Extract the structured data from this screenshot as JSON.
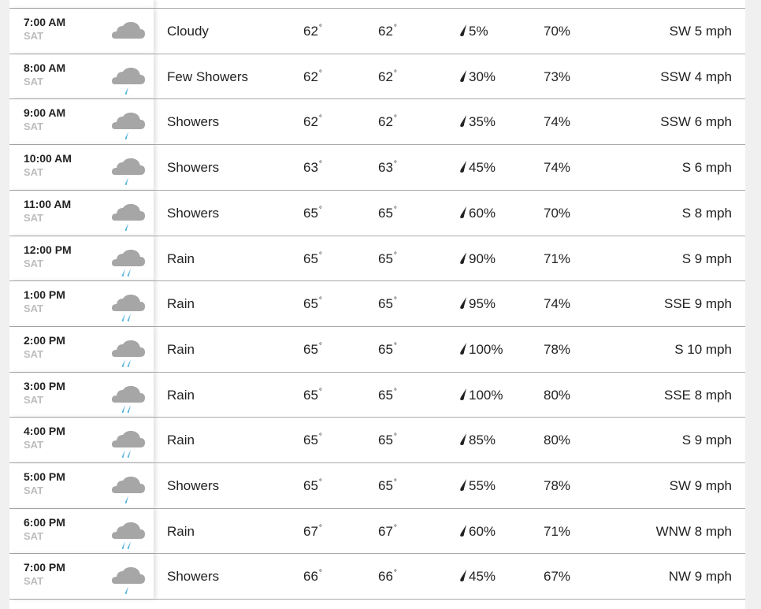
{
  "colors": {
    "cloud": "#a6a6a6",
    "drop": "#5bb6e0",
    "text": "#222222",
    "day": "#bdbdbd"
  },
  "degree_symbol": "°",
  "rows": [
    {
      "time": "7:00 AM",
      "day": "SAT",
      "icon": "cloudy-icon",
      "condition": "Cloudy",
      "temp": "62",
      "feels": "62",
      "precip": "5%",
      "humidity": "70%",
      "wind": "SW 5 mph"
    },
    {
      "time": "8:00 AM",
      "day": "SAT",
      "icon": "showers-icon",
      "condition": "Few Showers",
      "temp": "62",
      "feels": "62",
      "precip": "30%",
      "humidity": "73%",
      "wind": "SSW 4 mph"
    },
    {
      "time": "9:00 AM",
      "day": "SAT",
      "icon": "showers-icon",
      "condition": "Showers",
      "temp": "62",
      "feels": "62",
      "precip": "35%",
      "humidity": "74%",
      "wind": "SSW 6 mph"
    },
    {
      "time": "10:00 AM",
      "day": "SAT",
      "icon": "showers-icon",
      "condition": "Showers",
      "temp": "63",
      "feels": "63",
      "precip": "45%",
      "humidity": "74%",
      "wind": "S 6 mph"
    },
    {
      "time": "11:00 AM",
      "day": "SAT",
      "icon": "showers-icon",
      "condition": "Showers",
      "temp": "65",
      "feels": "65",
      "precip": "60%",
      "humidity": "70%",
      "wind": "S 8 mph"
    },
    {
      "time": "12:00 PM",
      "day": "SAT",
      "icon": "rain-icon",
      "condition": "Rain",
      "temp": "65",
      "feels": "65",
      "precip": "90%",
      "humidity": "71%",
      "wind": "S 9 mph"
    },
    {
      "time": "1:00 PM",
      "day": "SAT",
      "icon": "rain-icon",
      "condition": "Rain",
      "temp": "65",
      "feels": "65",
      "precip": "95%",
      "humidity": "74%",
      "wind": "SSE 9 mph"
    },
    {
      "time": "2:00 PM",
      "day": "SAT",
      "icon": "rain-icon",
      "condition": "Rain",
      "temp": "65",
      "feels": "65",
      "precip": "100%",
      "humidity": "78%",
      "wind": "S 10 mph"
    },
    {
      "time": "3:00 PM",
      "day": "SAT",
      "icon": "rain-icon",
      "condition": "Rain",
      "temp": "65",
      "feels": "65",
      "precip": "100%",
      "humidity": "80%",
      "wind": "SSE 8 mph"
    },
    {
      "time": "4:00 PM",
      "day": "SAT",
      "icon": "rain-icon",
      "condition": "Rain",
      "temp": "65",
      "feels": "65",
      "precip": "85%",
      "humidity": "80%",
      "wind": "S 9 mph"
    },
    {
      "time": "5:00 PM",
      "day": "SAT",
      "icon": "showers-icon",
      "condition": "Showers",
      "temp": "65",
      "feels": "65",
      "precip": "55%",
      "humidity": "78%",
      "wind": "SW 9 mph"
    },
    {
      "time": "6:00 PM",
      "day": "SAT",
      "icon": "rain-icon",
      "condition": "Rain",
      "temp": "67",
      "feels": "67",
      "precip": "60%",
      "humidity": "71%",
      "wind": "WNW 8 mph"
    },
    {
      "time": "7:00 PM",
      "day": "SAT",
      "icon": "showers-icon",
      "condition": "Showers",
      "temp": "66",
      "feels": "66",
      "precip": "45%",
      "humidity": "67%",
      "wind": "NW 9 mph"
    }
  ]
}
